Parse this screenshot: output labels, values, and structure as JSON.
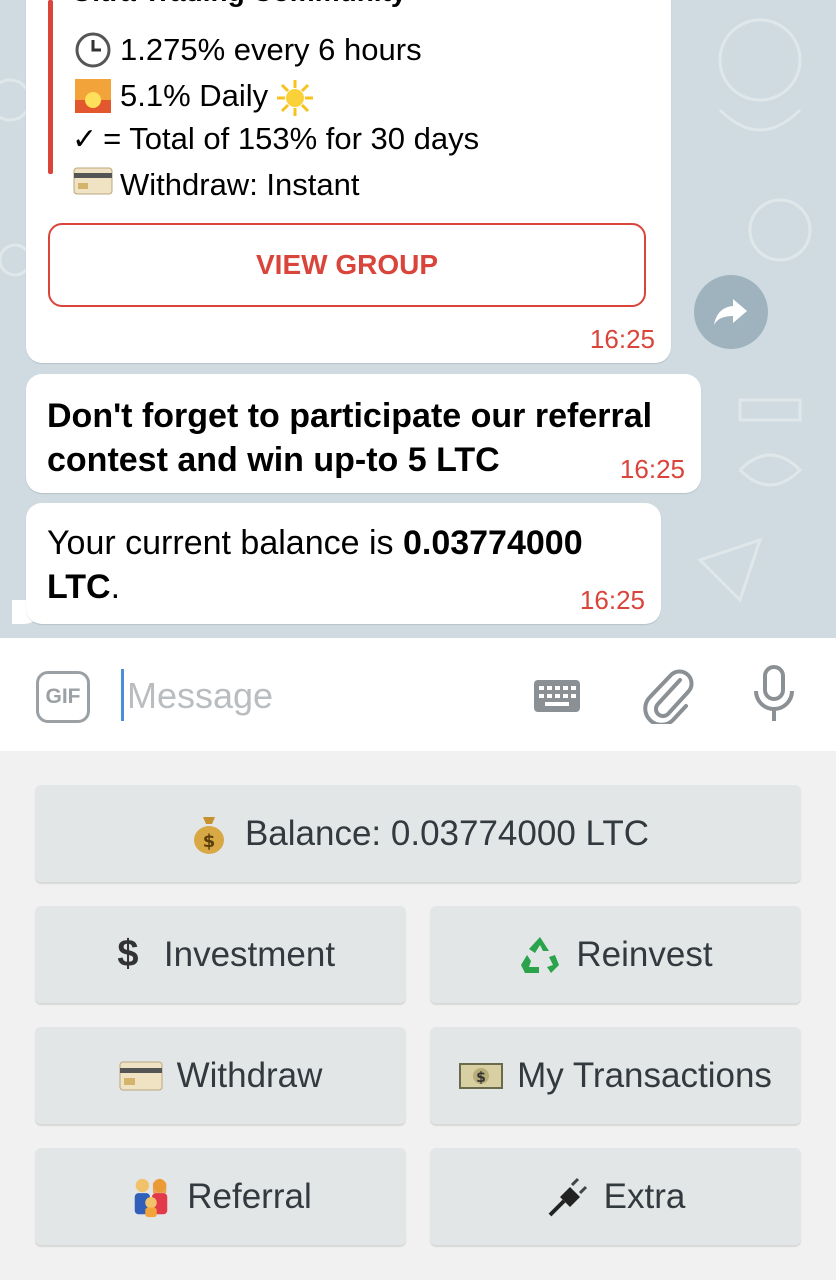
{
  "chat": {
    "forwarded_card": {
      "title": "Ultra Trading Community",
      "lines": [
        {
          "icon": "clock-icon",
          "text": "1.275% every 6 hours"
        },
        {
          "icon": "sunrise-icon",
          "text": "5.1%  Daily"
        },
        {
          "icon": "checkmark-icon",
          "text": "= Total of 153% for 30 days"
        },
        {
          "icon": "credit-card-icon",
          "text": "Withdraw:  Instant"
        }
      ],
      "button_label": "VIEW GROUP",
      "time": "16:25"
    },
    "messages": [
      {
        "text": "Don't forget to  participate our referral contest and win up-to 5 LTC",
        "time": "16:25"
      },
      {
        "text_prefix": "Your current balance is ",
        "text_bold": "0.03774000 LTC",
        "text_suffix": ".",
        "time": "16:25"
      }
    ]
  },
  "input": {
    "gif_label": "GIF",
    "placeholder": "Message"
  },
  "keyboard": {
    "buttons": [
      {
        "label": "Balance: 0.03774000 LTC",
        "icon": "money-bag-icon"
      },
      {
        "label": "Investment",
        "icon": "dollar-sign-icon"
      },
      {
        "label": "Reinvest",
        "icon": "recycle-icon"
      },
      {
        "label": "Withdraw",
        "icon": "credit-card-icon"
      },
      {
        "label": "My Transactions",
        "icon": "banknote-icon"
      },
      {
        "label": "Referral",
        "icon": "family-icon"
      },
      {
        "label": "Extra",
        "icon": "plug-icon"
      }
    ]
  },
  "colors": {
    "accent": "#d9453b",
    "chat_background": "#cfdbe1",
    "keyboard_button": "#e3e6e7"
  }
}
